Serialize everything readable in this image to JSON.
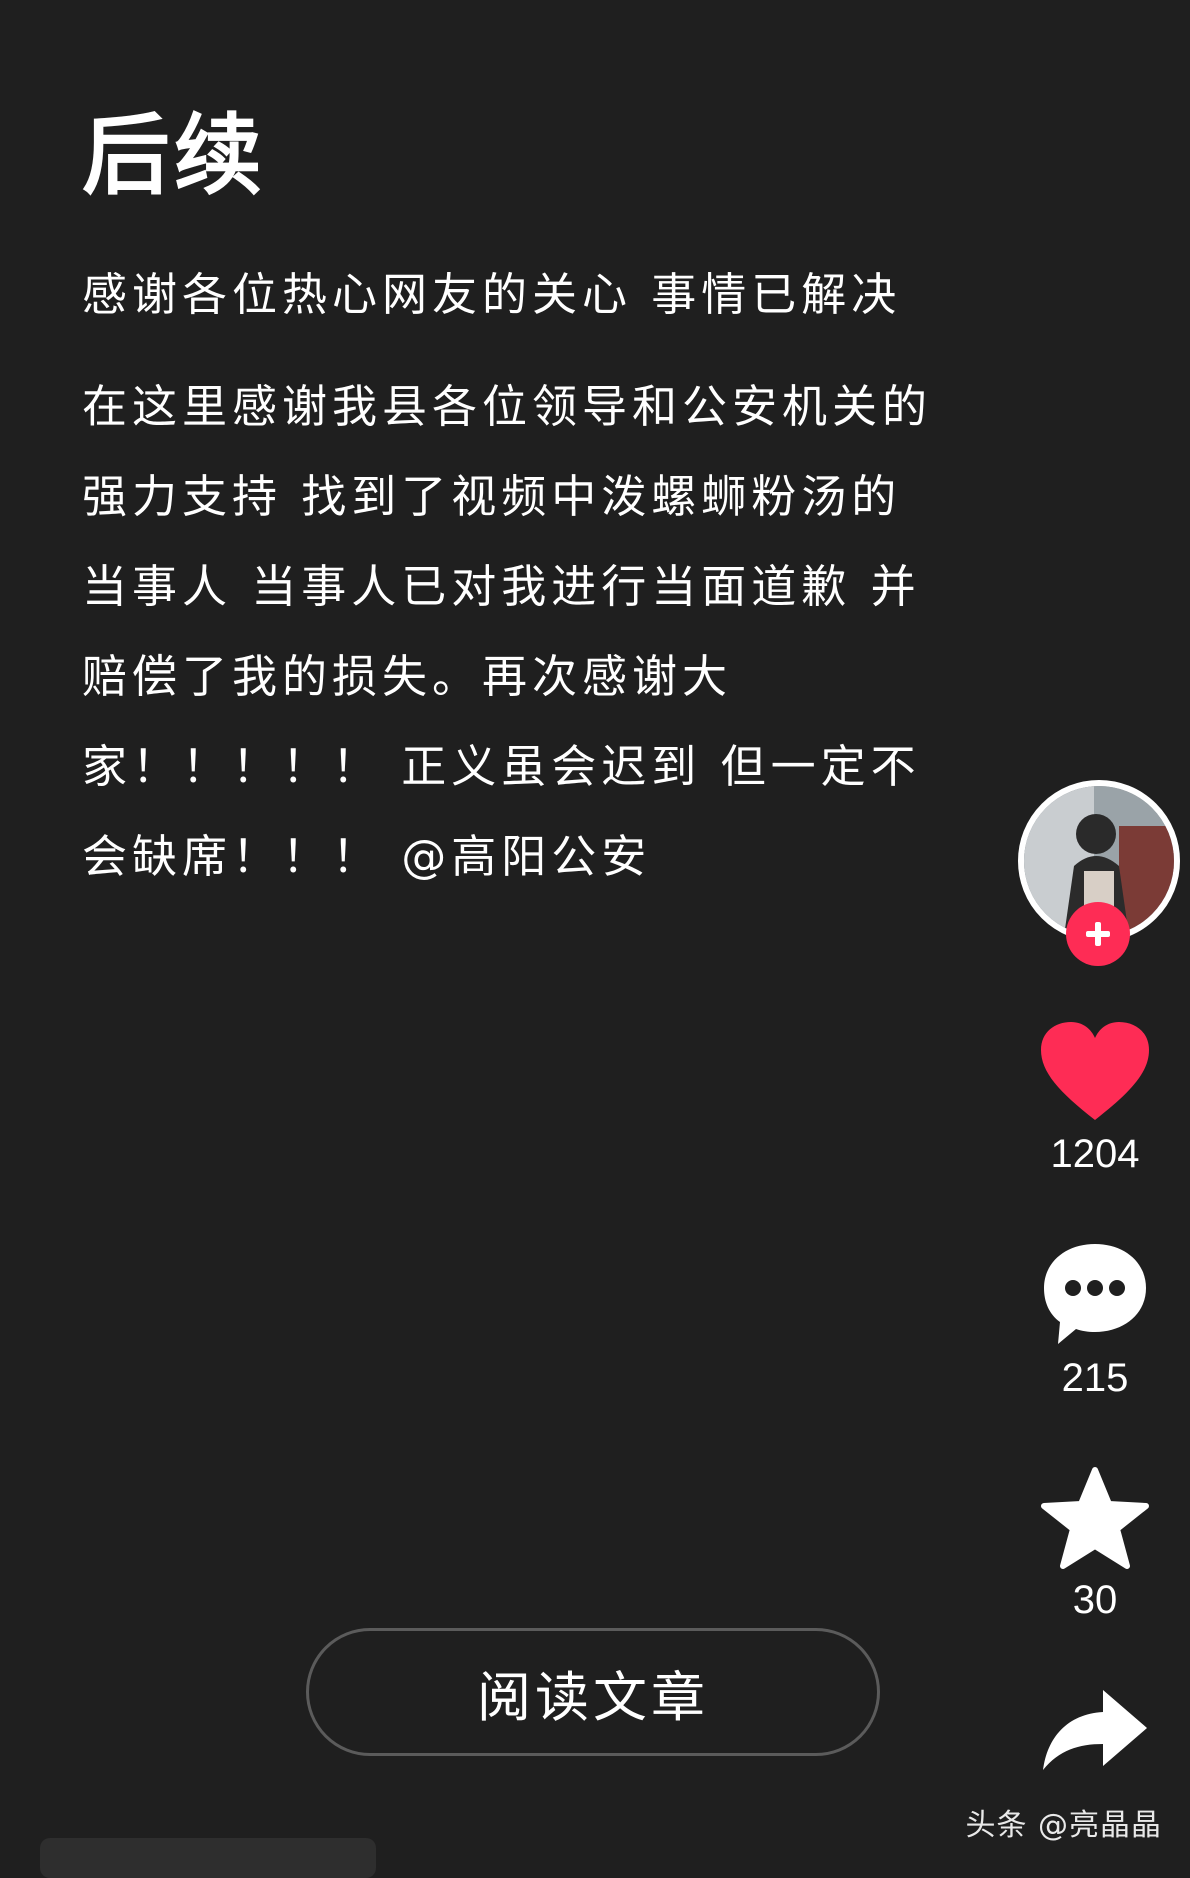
{
  "post": {
    "title": "后续",
    "paragraph_1": "感谢各位热心网友的关心  事情已解决",
    "paragraph_2": "在这里感谢我县各位领导和公安机关的强力支持 找到了视频中泼螺蛳粉汤的当事人 当事人已对我进行当面道歉 并赔偿了我的损失。再次感谢大家！！！！！ 正义虽会迟到 但一定不会缺席！！！ @高阳公安"
  },
  "actions": {
    "like_count": "1204",
    "comment_count": "215",
    "favorite_count": "30",
    "share_count": "",
    "accent_color": "#fe2c55"
  },
  "read_button": {
    "label": "阅读文章"
  },
  "watermark": {
    "text": "头条 @亮晶晶"
  }
}
